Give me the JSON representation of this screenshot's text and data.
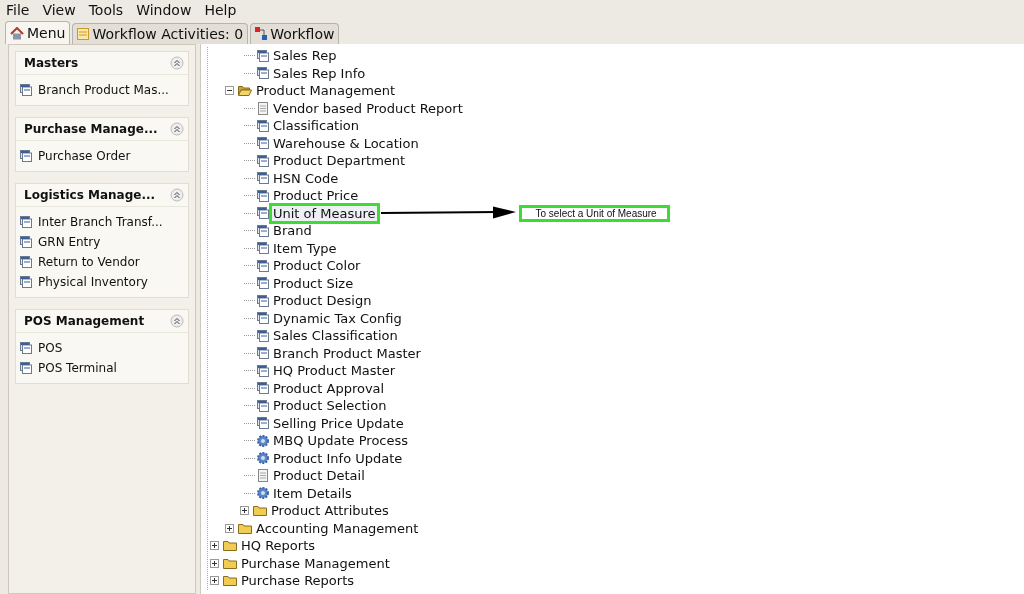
{
  "menu_bar": [
    {
      "label": "File"
    },
    {
      "label": "View"
    },
    {
      "label": "Tools"
    },
    {
      "label": "Window"
    },
    {
      "label": "Help"
    }
  ],
  "tabs": [
    {
      "label": "Menu",
      "kind": "home",
      "selected": true
    },
    {
      "label": "Workflow Activities: 0",
      "kind": "list",
      "selected": false
    },
    {
      "label": "Workflow",
      "kind": "flow",
      "selected": false
    }
  ],
  "sections": [
    {
      "title": "Masters",
      "items": [
        "Branch Product Mas..."
      ]
    },
    {
      "title": "Purchase Manage...",
      "items": [
        "Purchase Order"
      ]
    },
    {
      "title": "Logistics Manage...",
      "items": [
        "Inter Branch Transf...",
        "GRN Entry",
        "Return to Vendor",
        "Physical Inventory"
      ]
    },
    {
      "title": "POS Management",
      "items": [
        "POS",
        "POS Terminal"
      ]
    }
  ],
  "tree": [
    {
      "kind": "cut",
      "children": [
        {
          "kind": "cut",
          "children": [
            {
              "label": "Sales Rep",
              "kind": "form"
            },
            {
              "label": "Sales Rep Info",
              "kind": "form"
            }
          ]
        },
        {
          "label": "Product Management",
          "kind": "folder",
          "expanded": true,
          "children": [
            {
              "label": "Vendor based Product Report",
              "kind": "report"
            },
            {
              "label": "Classification",
              "kind": "form"
            },
            {
              "label": "Warehouse & Location",
              "kind": "form"
            },
            {
              "label": "Product Department",
              "kind": "form"
            },
            {
              "label": "HSN Code",
              "kind": "form"
            },
            {
              "label": "Product Price",
              "kind": "form"
            },
            {
              "label": "Unit of Measure",
              "kind": "form",
              "highlighted": true
            },
            {
              "label": "Brand",
              "kind": "form"
            },
            {
              "label": "Item Type",
              "kind": "form"
            },
            {
              "label": "Product Color",
              "kind": "form"
            },
            {
              "label": "Product Size",
              "kind": "form"
            },
            {
              "label": "Product Design",
              "kind": "form"
            },
            {
              "label": "Dynamic Tax Config",
              "kind": "form"
            },
            {
              "label": "Sales Classification",
              "kind": "form"
            },
            {
              "label": "Branch Product Master",
              "kind": "form"
            },
            {
              "label": "HQ Product Master",
              "kind": "form"
            },
            {
              "label": "Product Approval",
              "kind": "form"
            },
            {
              "label": "Product Selection",
              "kind": "form"
            },
            {
              "label": "Selling Price Update",
              "kind": "form"
            },
            {
              "label": "MBQ Update Process",
              "kind": "process"
            },
            {
              "label": "Product Info Update",
              "kind": "process"
            },
            {
              "label": "Product Detail",
              "kind": "report"
            },
            {
              "label": "Item Details",
              "kind": "process"
            },
            {
              "label": "Product Attributes",
              "kind": "folder",
              "expanded": false
            }
          ]
        },
        {
          "label": "Accounting Management",
          "kind": "folder",
          "expanded": false
        }
      ]
    },
    {
      "label": "HQ Reports",
      "kind": "folder",
      "expanded": false
    },
    {
      "label": "Purchase Management",
      "kind": "folder",
      "expanded": false
    },
    {
      "label": "Purchase Reports",
      "kind": "folder",
      "expanded": false
    }
  ],
  "callout": {
    "text": "To select a Unit of Measure"
  }
}
